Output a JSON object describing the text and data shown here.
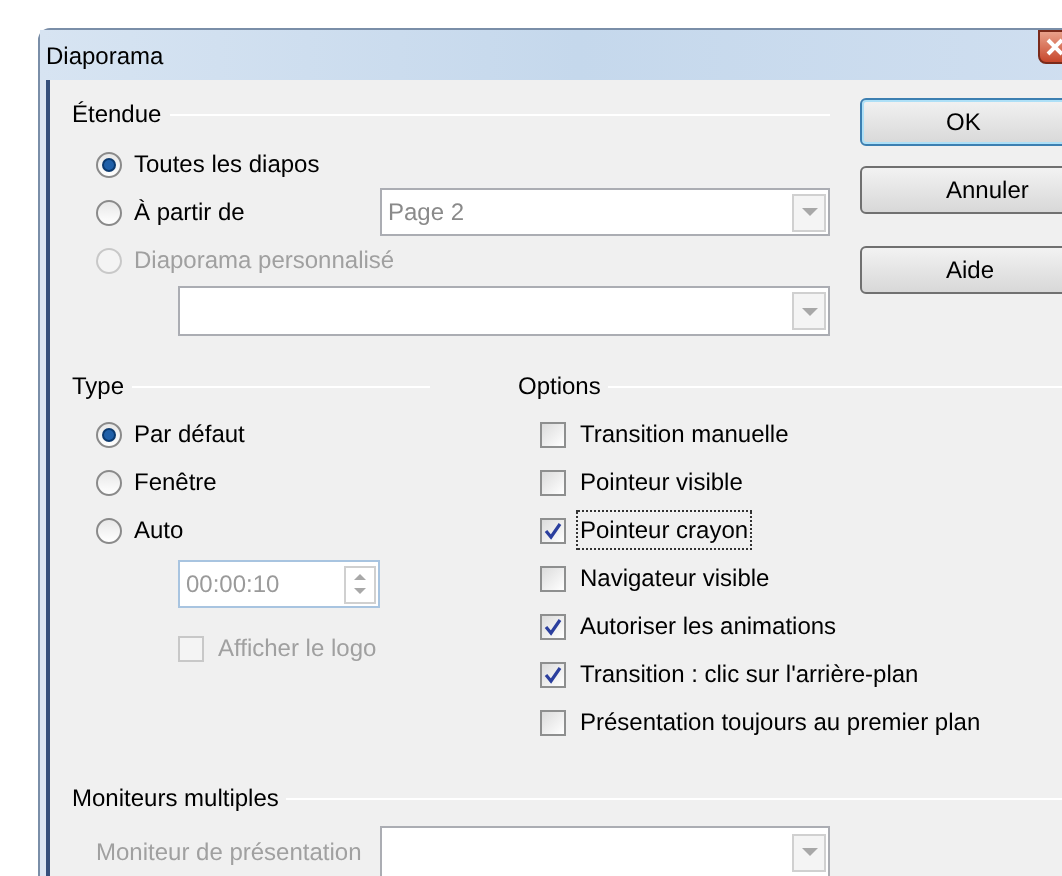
{
  "window": {
    "title": "Diaporama"
  },
  "scope": {
    "title": "Étendue",
    "options": [
      {
        "label": "Toutes les diapos",
        "selected": true,
        "disabled": false
      },
      {
        "label": "À partir de",
        "selected": false,
        "disabled": false
      },
      {
        "label": "Diaporama personnalisé",
        "selected": false,
        "disabled": true
      }
    ],
    "start_page": {
      "value": "Page 2"
    }
  },
  "buttons": [
    "OK",
    "Annuler",
    "Aide"
  ],
  "type": {
    "title": "Type",
    "options": [
      {
        "label": "Par défaut",
        "selected": true
      },
      {
        "label": "Fenêtre",
        "selected": false
      },
      {
        "label": "Auto",
        "selected": false
      }
    ],
    "duration": {
      "value": "00:00:10",
      "disabled": true
    },
    "show_logo": {
      "label": "Afficher le logo",
      "checked": false,
      "disabled": true
    }
  },
  "options": {
    "title": "Options",
    "items": [
      {
        "label": "Transition manuelle",
        "checked": false,
        "focused": false
      },
      {
        "label": "Pointeur visible",
        "checked": false,
        "focused": false
      },
      {
        "label": "Pointeur crayon",
        "checked": true,
        "focused": true
      },
      {
        "label": "Navigateur visible",
        "checked": false,
        "focused": false
      },
      {
        "label": "Autoriser les animations",
        "checked": true,
        "focused": false
      },
      {
        "label": "Transition : clic sur l'arrière-plan",
        "checked": true,
        "focused": false
      },
      {
        "label": "Présentation toujours au premier plan",
        "checked": false,
        "focused": false
      }
    ]
  },
  "monitors": {
    "title": "Moniteurs multiples",
    "label": "Moniteur de présentation",
    "disabled": true
  }
}
